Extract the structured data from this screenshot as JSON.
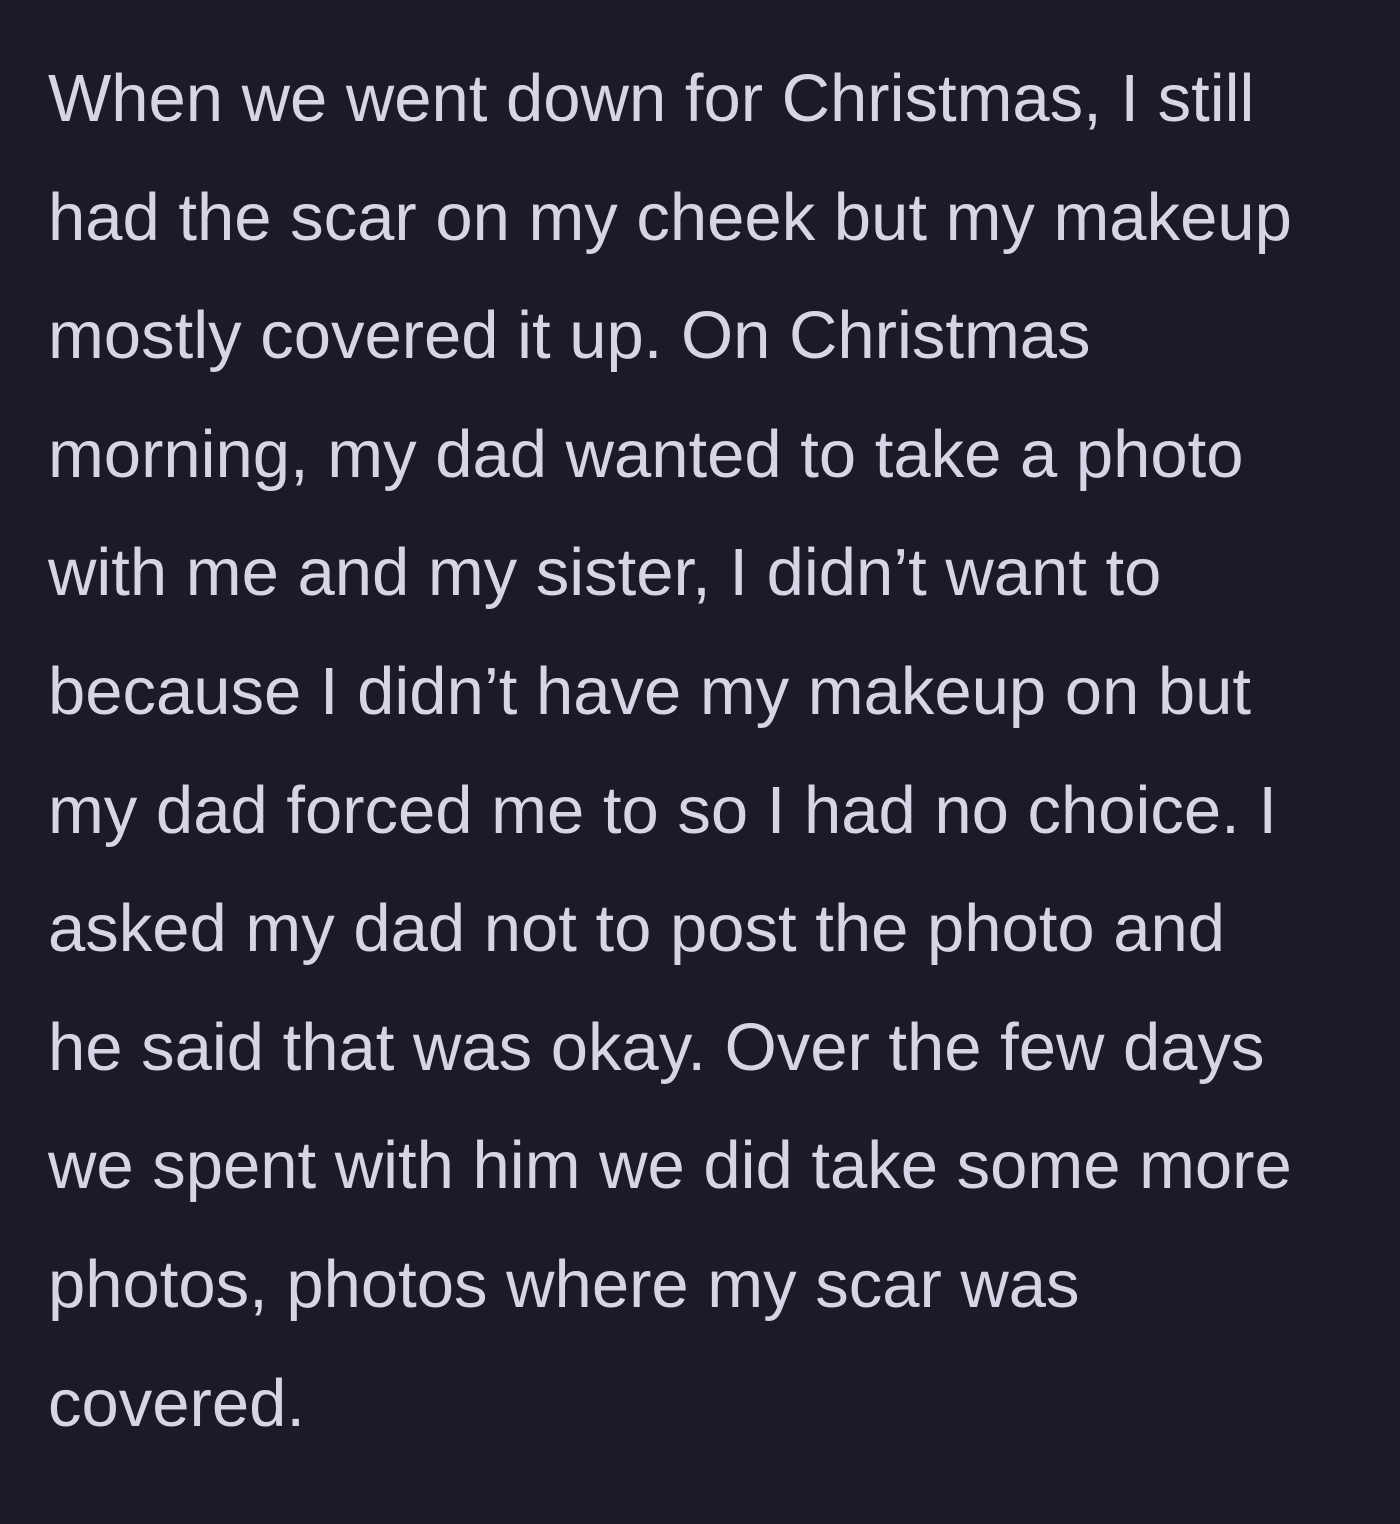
{
  "post": {
    "lines": [
      "When we went down for Christmas, I still",
      "had the scar on my cheek but my makeup",
      "mostly covered it up. On Christmas",
      "morning, my dad wanted to take a photo",
      "with me and my sister, I didn’t want to",
      "because I didn’t have my makeup on but",
      "my dad forced me to so I had no choice. I",
      "asked my dad not to post the photo and",
      "he said that was okay. Over the few days",
      "we spent with him we did take some more",
      "photos, photos where my scar was",
      "covered."
    ]
  },
  "colors": {
    "background": "#1c1a27",
    "text": "#d8d4e6"
  }
}
